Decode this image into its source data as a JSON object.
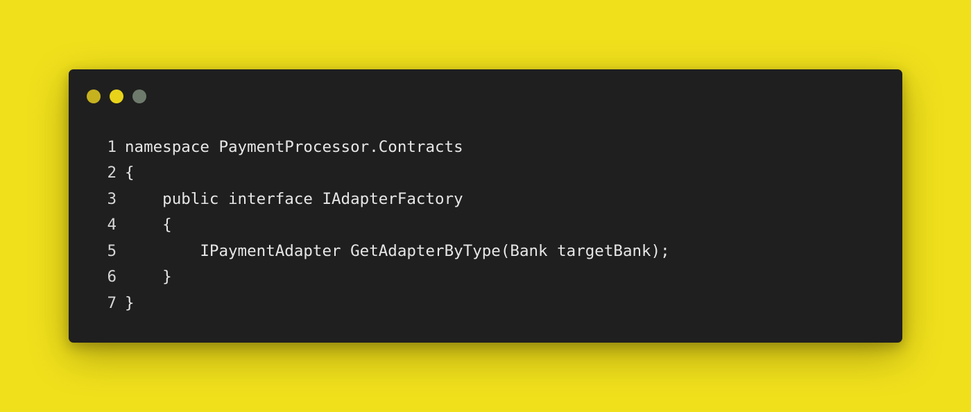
{
  "colors": {
    "background": "#f0e01c",
    "window": "#1f1f1f",
    "dot_red": "#c6b21f",
    "dot_yellow": "#e8d31a",
    "dot_green": "#6e7b6c",
    "code_text": "#e6e6e6"
  },
  "window_controls": [
    "close-dot",
    "minimize-dot",
    "maximize-dot"
  ],
  "code": {
    "lines": [
      {
        "number": "1",
        "text": "namespace PaymentProcessor.Contracts"
      },
      {
        "number": "2",
        "text": "{"
      },
      {
        "number": "3",
        "text": "    public interface IAdapterFactory"
      },
      {
        "number": "4",
        "text": "    {"
      },
      {
        "number": "5",
        "text": "        IPaymentAdapter GetAdapterByType(Bank targetBank);"
      },
      {
        "number": "6",
        "text": "    }"
      },
      {
        "number": "7",
        "text": "}"
      }
    ]
  }
}
